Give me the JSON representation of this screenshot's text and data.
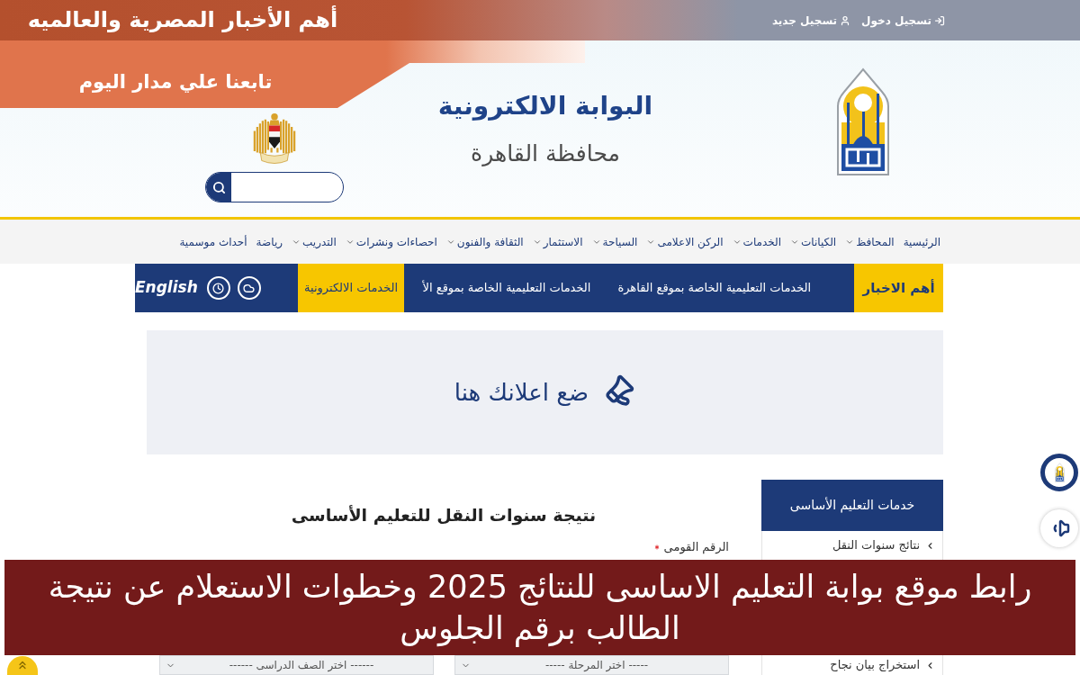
{
  "top_bar": {
    "account_links": [
      {
        "kind": "login",
        "label": "تسجيل دخول"
      },
      {
        "kind": "register",
        "label": "تسجيل جديد"
      }
    ]
  },
  "promo_banner": {
    "headline": "أهم الأخبار المصرية والعالميه",
    "subline": "تابعنا علي مدار اليوم"
  },
  "header": {
    "title": "البوابة الالكترونية",
    "subtitle": "محافظة القاهرة"
  },
  "main_nav": [
    {
      "label": "الرئيسية",
      "dropdown": false
    },
    {
      "label": "المحافظ",
      "dropdown": true
    },
    {
      "label": "الكيانات",
      "dropdown": true
    },
    {
      "label": "الخدمات",
      "dropdown": true
    },
    {
      "label": "الركن الاعلامى",
      "dropdown": true
    },
    {
      "label": "السياحة",
      "dropdown": true
    },
    {
      "label": "الاستثمار",
      "dropdown": true
    },
    {
      "label": "الثقافة والفنون",
      "dropdown": true
    },
    {
      "label": "احصاءات ونشرات",
      "dropdown": true
    },
    {
      "label": "التدريب",
      "dropdown": true
    },
    {
      "label": "رياضة",
      "dropdown": false
    },
    {
      "label": "أحداث موسمية",
      "dropdown": false
    }
  ],
  "ticker": {
    "heading": "أهم الاخبار",
    "items": [
      "الخدمات التعليمية الخاصة بموقع القاهرة",
      "الخدمات التعليمية الخاصة بموقع الأ"
    ],
    "services_link": "الخدمات الالكترونية",
    "language_link": "English"
  },
  "ad_banner": {
    "text": "ضع اعلانك هنا"
  },
  "result_form": {
    "title": "نتيجة سنوات النقل للتعليم الأساسى",
    "fields": [
      {
        "label": "الرقم القومى",
        "required": true
      }
    ],
    "selects": [
      {
        "placeholder": "----- اختر المرحلة -----"
      },
      {
        "placeholder": "------ اختر الصف الدراسى ------"
      }
    ]
  },
  "sidebar": {
    "title": "خدمات التعليم الأساسى",
    "items": [
      "نتائج سنوات النقل",
      "استخراج بيان نجاح"
    ]
  },
  "article_banner": {
    "title": "رابط موقع بوابة التعليم الاساسى للنتائج 2025 وخطوات الاستعلام عن نتيجة الطالب برقم الجلوس"
  }
}
